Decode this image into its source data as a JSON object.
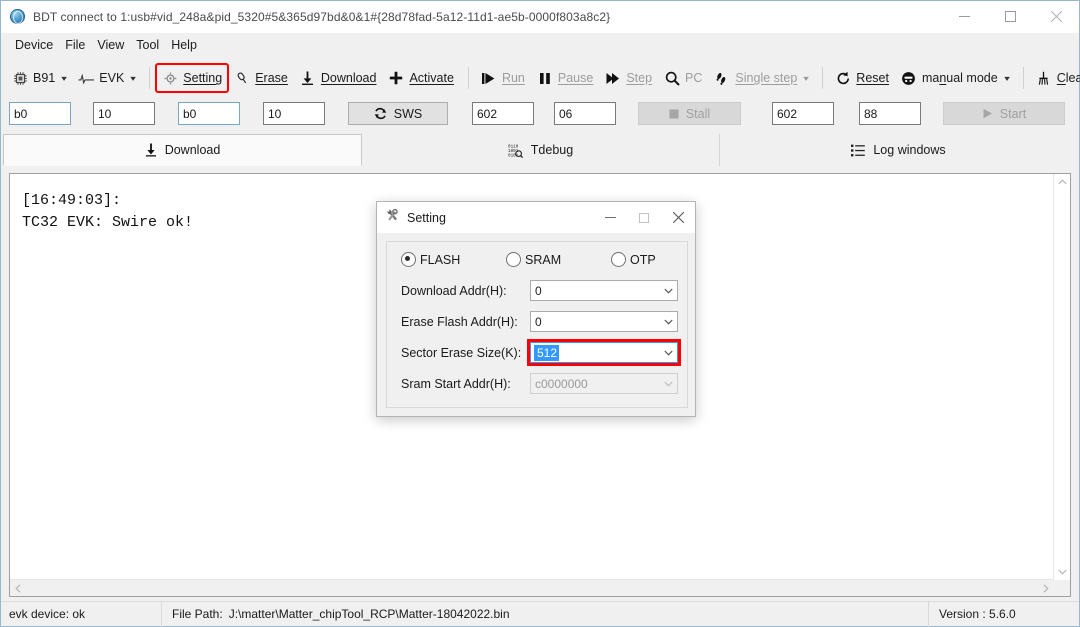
{
  "window": {
    "title": "BDT connect to 1:usb#vid_248a&pid_5320#5&365d97bd&0&1#{28d78fad-5a12-11d1-ae5b-0000f803a8c2}",
    "icon": "globe-icon",
    "minimize_label": "—",
    "maximize_label": "□",
    "close_label": "✕"
  },
  "menubar": {
    "items": [
      {
        "label": "Device"
      },
      {
        "label": "File"
      },
      {
        "label": "View"
      },
      {
        "label": "Tool"
      },
      {
        "label": "Help"
      }
    ]
  },
  "toolbar": {
    "items": [
      {
        "label": "B91",
        "icon": "chip-icon",
        "has_caret": true,
        "disabled": false,
        "highlighted": false
      },
      {
        "label": "EVK",
        "icon": "waveform-icon",
        "has_caret": true,
        "disabled": false,
        "highlighted": false
      },
      {
        "label": "Setting",
        "icon": "gear-icon",
        "has_caret": false,
        "disabled": false,
        "highlighted": true
      },
      {
        "label": "Erase",
        "icon": "eraser-icon",
        "has_caret": false,
        "disabled": false,
        "highlighted": false
      },
      {
        "label": "Download",
        "icon": "download-icon",
        "has_caret": false,
        "disabled": false,
        "highlighted": false
      },
      {
        "label": "Activate",
        "icon": "plus-icon",
        "has_caret": false,
        "disabled": false,
        "highlighted": false
      },
      {
        "label": "Run",
        "icon": "play-icon",
        "has_caret": false,
        "disabled": true,
        "highlighted": false
      },
      {
        "label": "Pause",
        "icon": "pause-icon",
        "has_caret": false,
        "disabled": true,
        "highlighted": false
      },
      {
        "label": "Step",
        "icon": "step-icon",
        "has_caret": false,
        "disabled": true,
        "highlighted": false
      },
      {
        "label": "PC",
        "icon": "magnifier-icon",
        "has_caret": false,
        "disabled": true,
        "highlighted": false
      },
      {
        "label": "Single step",
        "icon": "footsteps-icon",
        "has_caret": true,
        "disabled": true,
        "highlighted": false
      },
      {
        "label": "Reset",
        "icon": "refresh-icon",
        "has_caret": false,
        "disabled": false,
        "highlighted": false
      },
      {
        "label": "manual mode",
        "icon": "mode-icon",
        "has_caret": true,
        "disabled": false,
        "highlighted": false
      },
      {
        "label": "Clear",
        "icon": "broom-icon",
        "has_caret": false,
        "disabled": false,
        "highlighted": false
      }
    ]
  },
  "fieldrow": {
    "fields": [
      {
        "name": "field-1",
        "value": "b0"
      },
      {
        "name": "field-2",
        "value": "10"
      },
      {
        "name": "field-3",
        "value": "b0"
      },
      {
        "name": "field-4",
        "value": "10"
      },
      {
        "name": "field-5",
        "value": "602"
      },
      {
        "name": "field-6",
        "value": "06"
      },
      {
        "name": "field-7",
        "value": "602"
      },
      {
        "name": "field-8",
        "value": "88"
      }
    ],
    "sws_button": {
      "label": "SWS",
      "icon": "refresh-icon",
      "disabled": false
    },
    "stall_button": {
      "label": "Stall",
      "icon": "stop-icon",
      "disabled": true
    },
    "start_button": {
      "label": "Start",
      "icon": "play-icon",
      "disabled": true
    }
  },
  "tabs": [
    {
      "label": "Download",
      "icon": "download-icon",
      "active": true
    },
    {
      "label": "Tdebug",
      "icon": "binary-search-icon",
      "active": false
    },
    {
      "label": "Log windows",
      "icon": "list-icon",
      "active": false
    }
  ],
  "log": {
    "lines": "[16:49:03]:\nTC32 EVK: Swire ok!"
  },
  "statusbar": {
    "device_status": "evk device: ok",
    "file_path_label": "File Path:",
    "file_path_value": "J:\\matter\\Matter_chipTool_RCP\\Matter-18042022.bin",
    "version": "Version : 5.6.0"
  },
  "dialog": {
    "title": "Setting",
    "icon": "setting-tools-icon",
    "minimize_label": "—",
    "maximize_label": "□",
    "close_label": "✕",
    "memory_options": [
      {
        "label": "FLASH",
        "checked": true
      },
      {
        "label": "SRAM",
        "checked": false
      },
      {
        "label": "OTP",
        "checked": false
      }
    ],
    "rows": [
      {
        "label": "Download  Addr(H):",
        "value": "0",
        "disabled": false,
        "focused": false,
        "highlighted": false,
        "selected": false
      },
      {
        "label": "Erase Flash Addr(H):",
        "value": "0",
        "disabled": false,
        "focused": false,
        "highlighted": false,
        "selected": false
      },
      {
        "label": "Sector Erase Size(K):",
        "value": "512",
        "disabled": false,
        "focused": true,
        "highlighted": true,
        "selected": true
      },
      {
        "label": "Sram Start Addr(H):",
        "value": "c0000000",
        "disabled": true,
        "focused": false,
        "highlighted": false,
        "selected": false
      }
    ]
  },
  "colors": {
    "highlight_red": "#ff0000",
    "selection_blue": "#3399ff",
    "window_bg": "#f0f0f0",
    "content_bg": "#ffffff"
  }
}
